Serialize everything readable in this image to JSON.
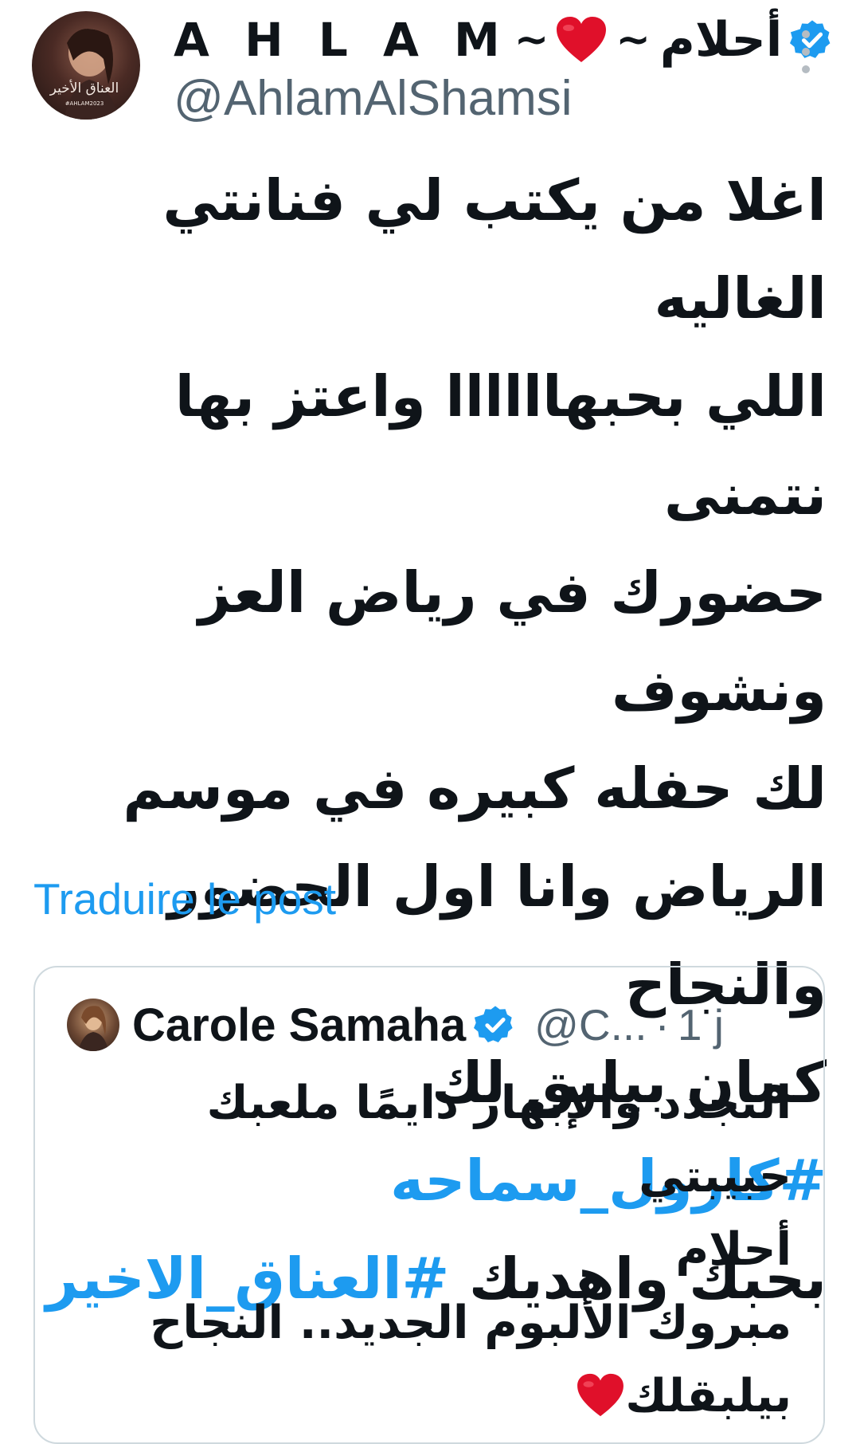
{
  "author": {
    "display_name_latin": "A H L A M",
    "display_name_sep_left": "~",
    "display_name_sep_right": "~",
    "display_name_arabic": "أحلام",
    "handle": "@AhlamAlShamsi",
    "avatar_caption": "العناق الأخير",
    "avatar_subcaption": "#AHLAM2023",
    "verified": true,
    "heart_color": "#e0102a"
  },
  "tweet": {
    "lines": [
      "اغلا من يكتب لي فنانتي الغاليه",
      "اللي بحبهاااااا واعتز بها نتمنى",
      "حضورك في رياض العز ونشوف",
      "لك حفله كبيره في موسم",
      "الرياض وانا اول الحضور والنجاح"
    ],
    "line6_text": "كمان بيلبق لك",
    "hashtag1": "#كارول_سماحه",
    "line7_text": "بحبك واهديك",
    "hashtag2": "#العناق_الاخير",
    "translate_label": "Traduire le post"
  },
  "quoted": {
    "name": "Carole Samaha",
    "handle": "@C...",
    "separator": "·",
    "time": "1 j",
    "verified": true,
    "lines": [
      "التجدد والإبهار دايمًا ملعبك حبيبتي",
      "أحلام",
      "مبروك الألبوم الجديد.. النجاح",
      "بيلبقلك"
    ]
  },
  "colors": {
    "accent": "#1d9bf0",
    "text": "#0f1419",
    "secondary": "#536471",
    "border": "#cfd9de",
    "heart": "#e0102a"
  },
  "icons": {
    "verified": "verified-badge-icon",
    "more": "more-vertical-icon",
    "heart": "red-heart-icon"
  }
}
